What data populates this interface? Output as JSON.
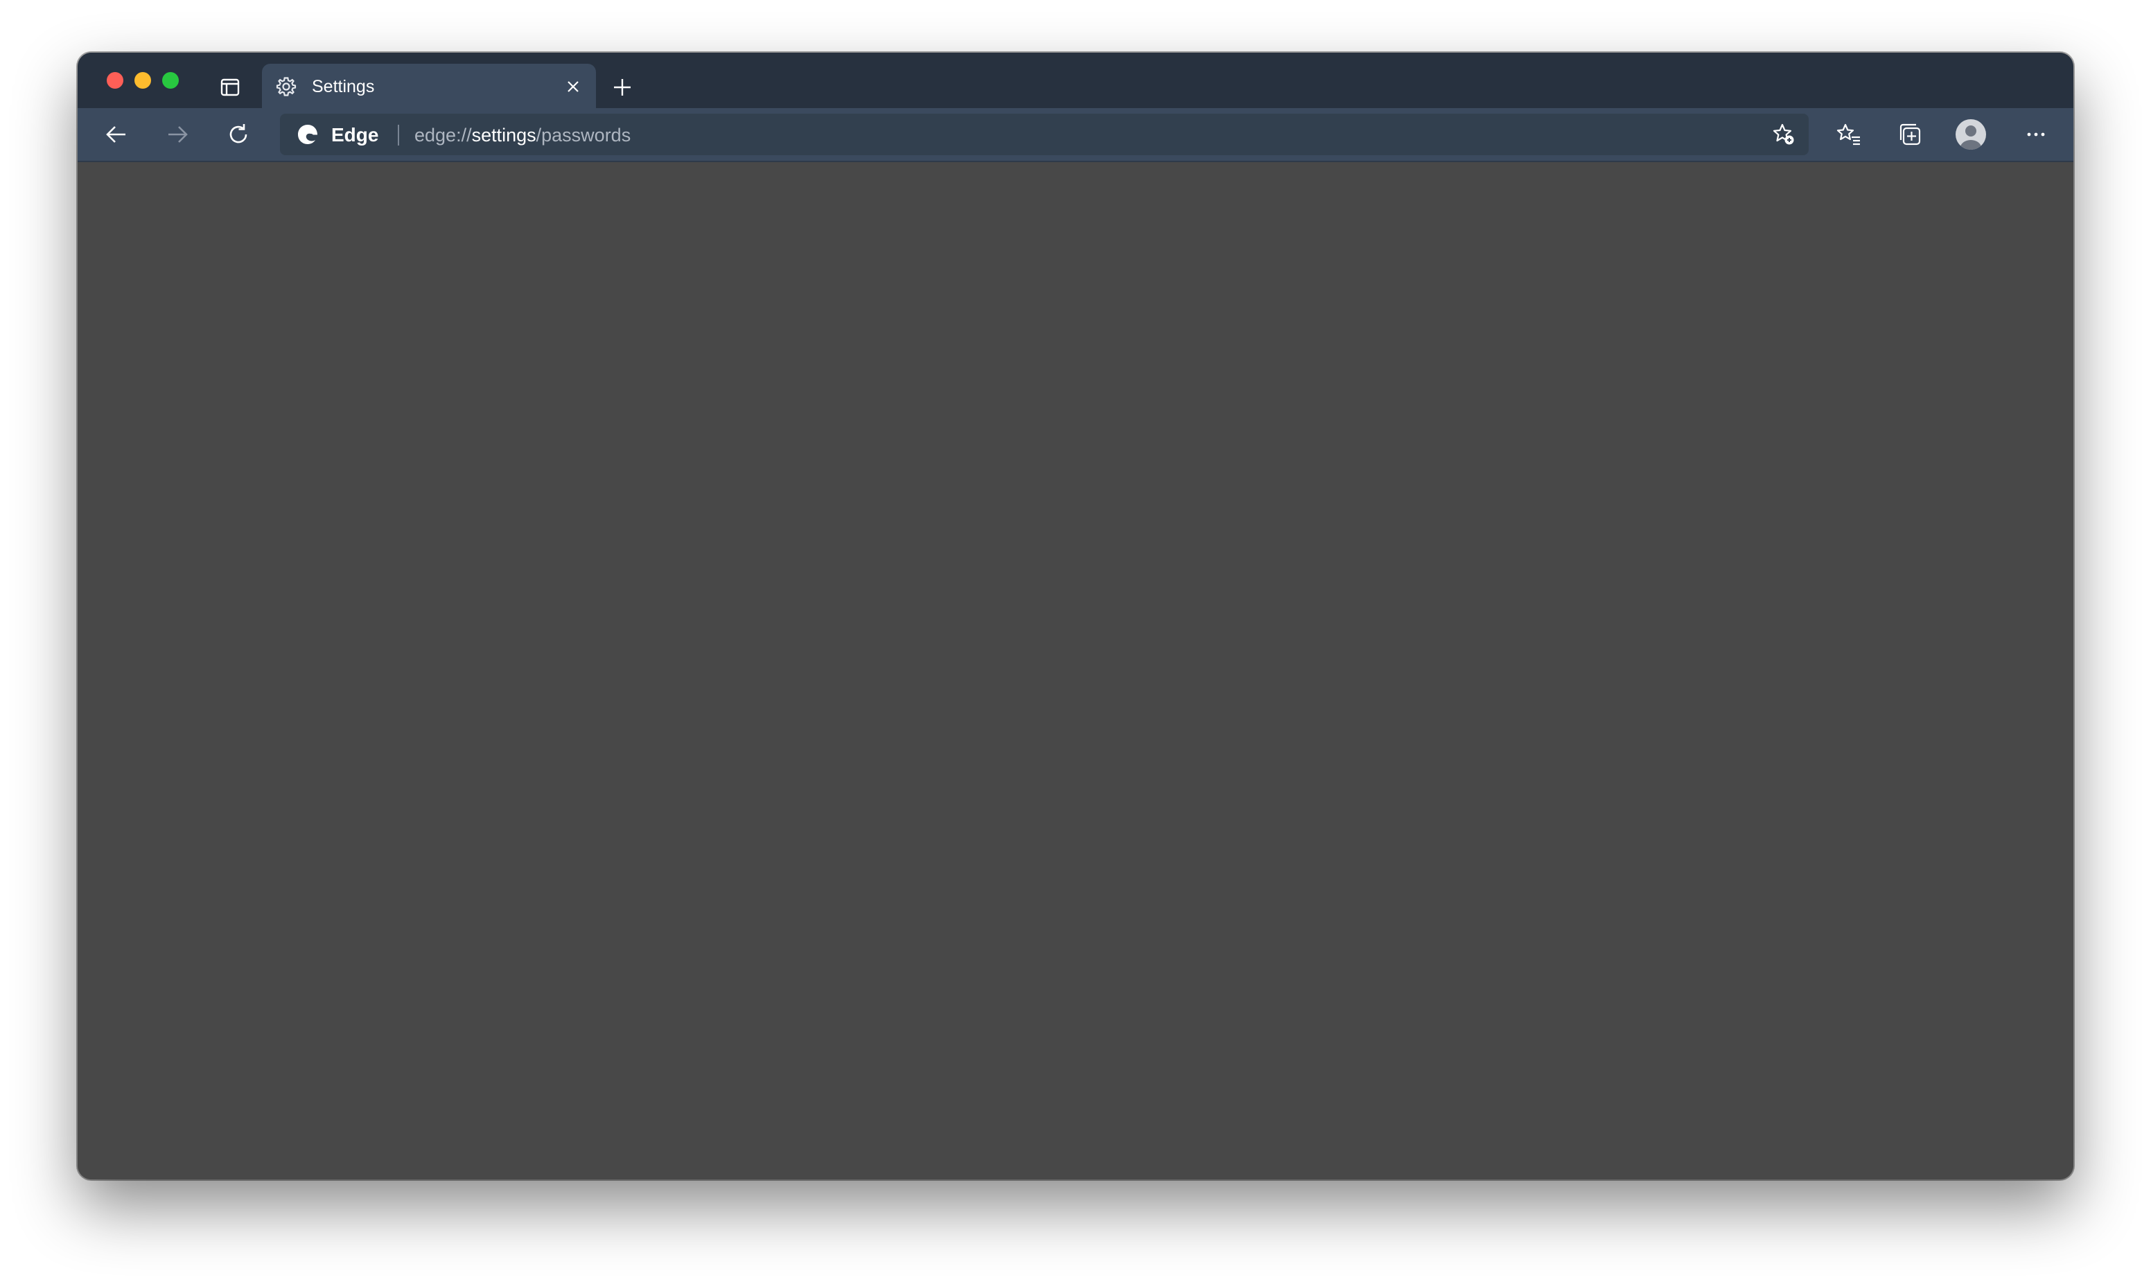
{
  "window": {
    "traffic_lights": [
      "close",
      "minimize",
      "zoom"
    ]
  },
  "tab": {
    "title": "Settings",
    "icon": "gear-icon"
  },
  "address_bar": {
    "site_label": "Edge",
    "url_prefix": "edge://",
    "url_highlight": "settings",
    "url_suffix": "/passwords"
  },
  "toolbar": {
    "icons": [
      "back-arrow-icon",
      "forward-arrow-icon",
      "refresh-icon",
      "add-favorite-icon",
      "favorites-icon",
      "collections-icon",
      "profile-avatar-icon",
      "more-icon"
    ]
  },
  "colors": {
    "titlebar": "#27313f",
    "toolbar": "#3b4a5e",
    "content": "#484848"
  }
}
